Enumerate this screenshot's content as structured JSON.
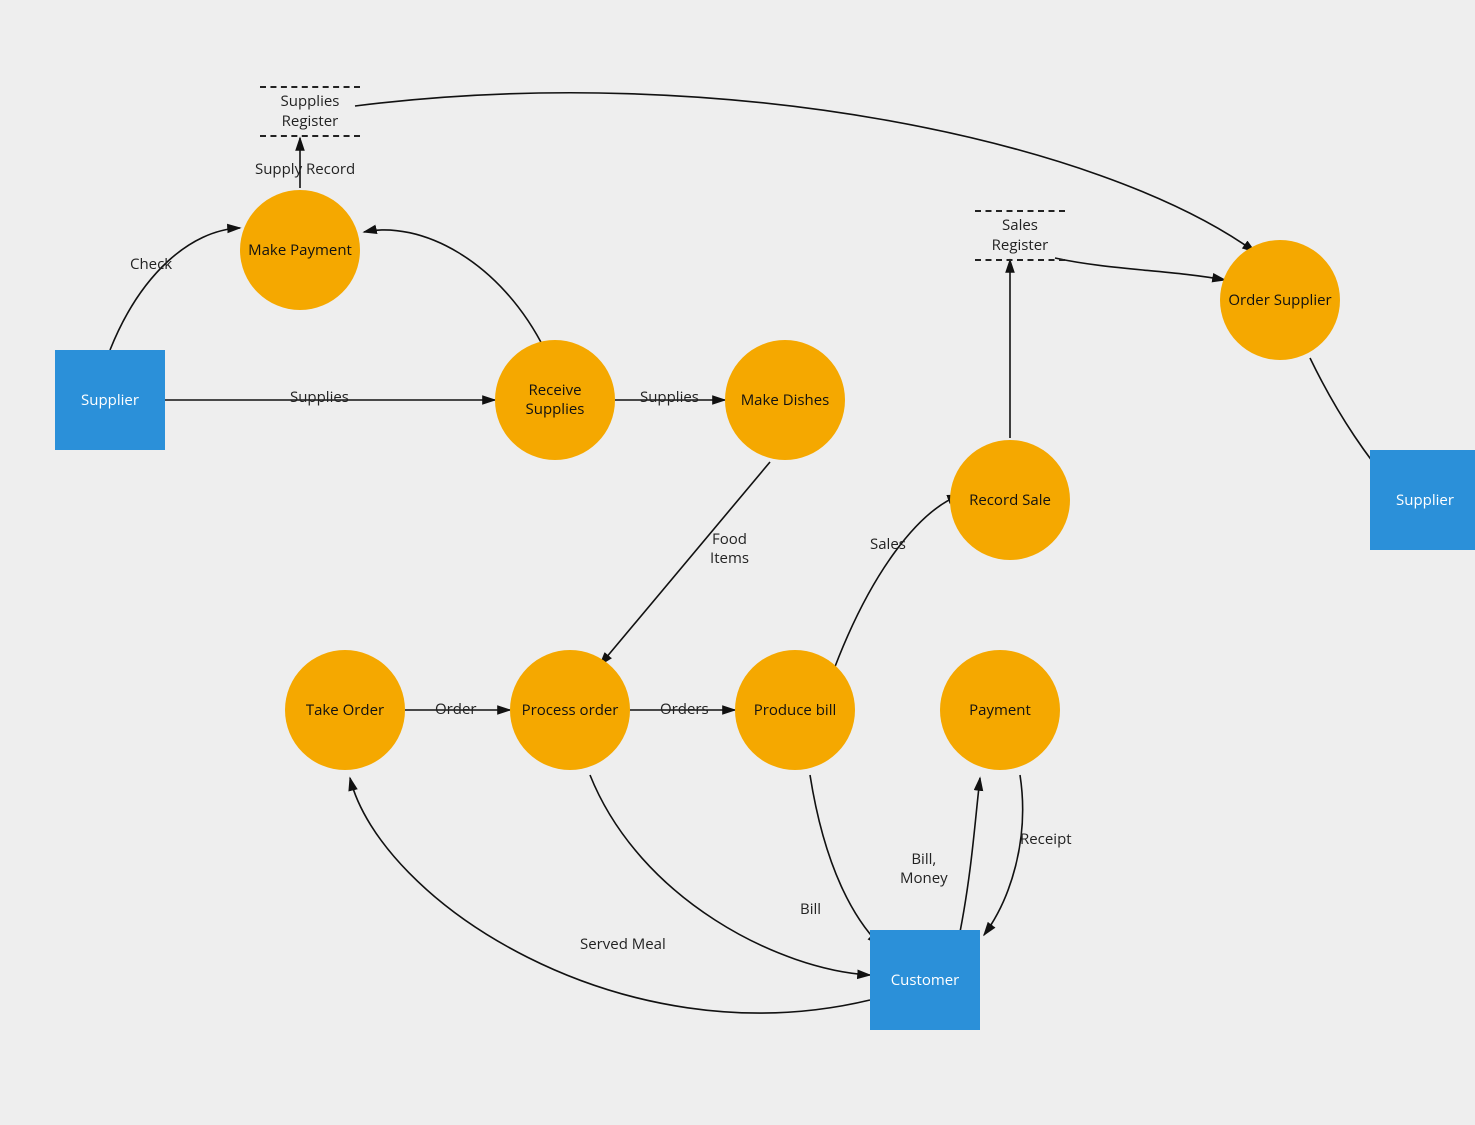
{
  "entities": {
    "supplier_left": "Supplier",
    "supplier_right": "Supplier",
    "customer": "Customer"
  },
  "processes": {
    "make_payment": "Make\nPayment",
    "receive_supplies": "Receive\nSupplies",
    "make_dishes": "Make Dishes",
    "record_sale": "Record Sale",
    "order_supplier": "Order Supplier",
    "take_order": "Take Order",
    "process_order": "Process order",
    "produce_bill": "Produce bill",
    "payment": "Payment"
  },
  "stores": {
    "supplies_register": "Supplies\nRegister",
    "sales_register": "Sales\nRegister"
  },
  "edge_labels": {
    "check": "Check",
    "supply_record": "Supply Record",
    "supplies_1": "Supplies",
    "supplies_2": "Supplies",
    "food_items": "Food\nItems",
    "sales": "Sales",
    "order": "Order",
    "orders": "Orders",
    "served_meal": "Served Meal",
    "bill": "Bill",
    "bill_money": "Bill,\nMoney",
    "receipt": "Receipt"
  }
}
